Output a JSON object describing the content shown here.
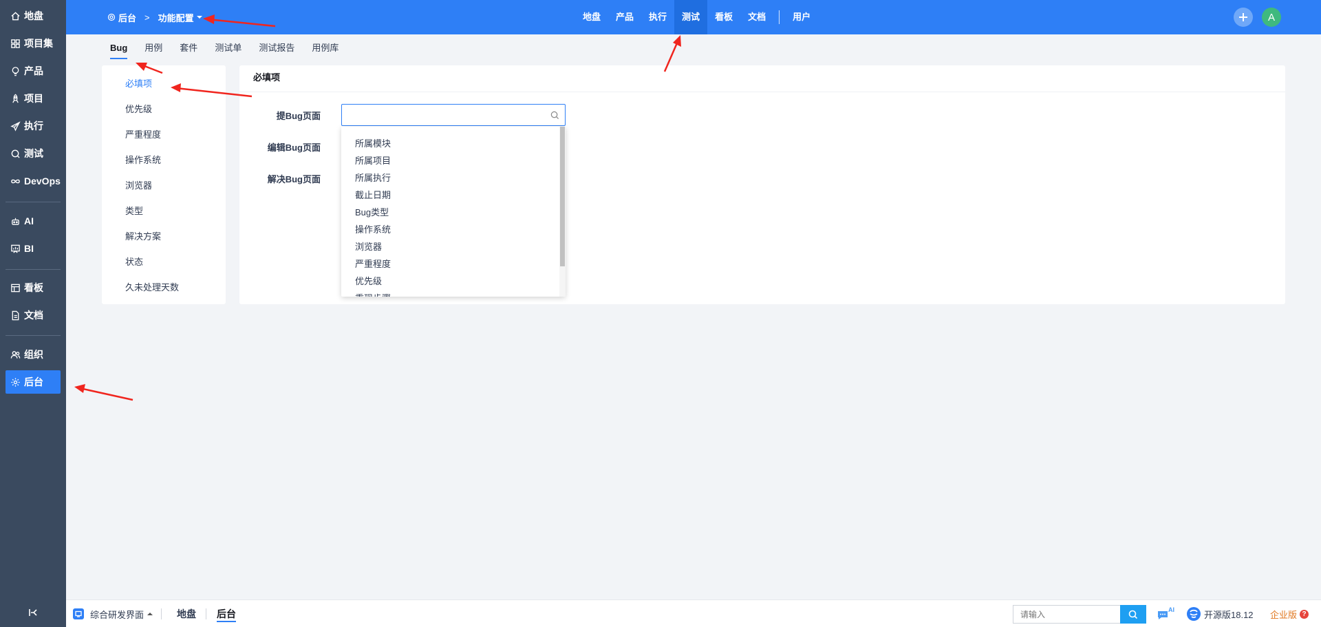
{
  "sidebar": {
    "items": [
      {
        "label": "地盘",
        "icon": "home-icon"
      },
      {
        "label": "项目集",
        "icon": "grid-icon"
      },
      {
        "label": "产品",
        "icon": "bulb-icon"
      },
      {
        "label": "项目",
        "icon": "rocket-icon"
      },
      {
        "label": "执行",
        "icon": "send-icon"
      },
      {
        "label": "测试",
        "icon": "search-test-icon"
      },
      {
        "label": "DevOps",
        "icon": "infinity-icon"
      },
      {
        "label": "AI",
        "icon": "robot-icon"
      },
      {
        "label": "BI",
        "icon": "board-chart-icon"
      },
      {
        "label": "看板",
        "icon": "kanban-icon"
      },
      {
        "label": "文档",
        "icon": "doc-icon"
      },
      {
        "label": "组织",
        "icon": "people-icon"
      },
      {
        "label": "后台",
        "icon": "gear-icon"
      }
    ],
    "active": "后台"
  },
  "header": {
    "breadcrumb_home": "后台",
    "breadcrumb_current": "功能配置",
    "nav": [
      "地盘",
      "产品",
      "执行",
      "测试",
      "看板",
      "文档"
    ],
    "nav_extra": "用户",
    "active_nav": "测试",
    "avatar_letter": "A"
  },
  "subtabs": [
    "Bug",
    "用例",
    "套件",
    "测试单",
    "测试报告",
    "用例库"
  ],
  "active_subtab": "Bug",
  "left_menu": [
    "必填项",
    "优先级",
    "严重程度",
    "操作系统",
    "浏览器",
    "类型",
    "解决方案",
    "状态",
    "久未处理天数"
  ],
  "active_left_menu": "必填项",
  "panel": {
    "title": "必填项",
    "fields": [
      "提Bug页面",
      "编辑Bug页面",
      "解决Bug页面"
    ],
    "picker_value": "",
    "dropdown_options": [
      "所属模块",
      "所属项目",
      "所属执行",
      "截止日期",
      "Bug类型",
      "操作系统",
      "浏览器",
      "严重程度",
      "优先级",
      "重现步骤"
    ]
  },
  "bottom": {
    "app_label": "综合研发界面",
    "tabs": [
      "地盘",
      "后台"
    ],
    "active_tab": "后台",
    "search_placeholder": "请输入",
    "ai_badge": "AI",
    "version": "开源版18.12",
    "edition": "企业版",
    "edition_badge": "?"
  },
  "colors": {
    "primary": "#2e7ff6",
    "sidebar_bg": "#3a4a5f",
    "annotation_arrow": "#f0251e",
    "avatar_bg": "#3fb97e"
  }
}
